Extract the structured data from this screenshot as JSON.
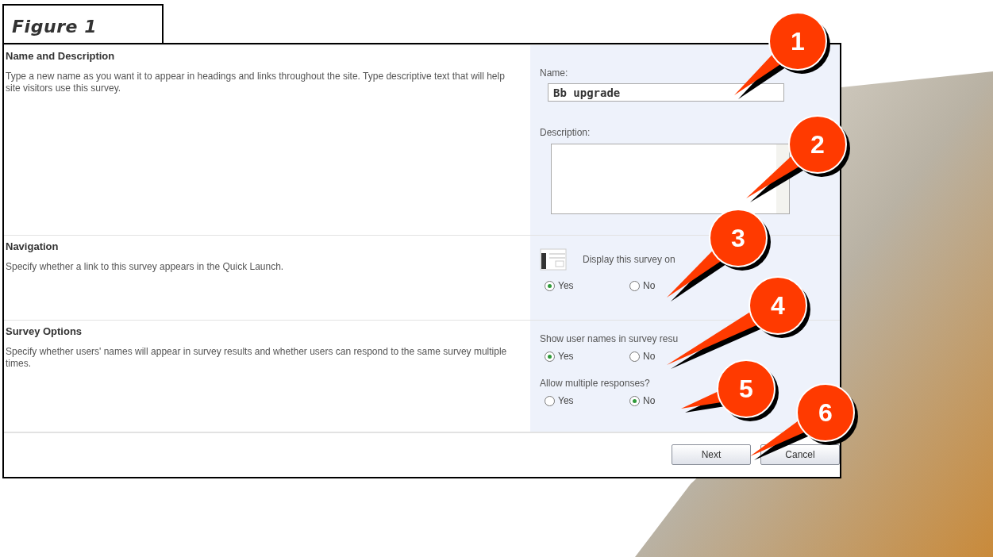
{
  "figure_label": "Figure 1",
  "sections": [
    {
      "title": "Name and Description",
      "description": "Type a new name as you want it to appear in headings and links throughout the site. Type descriptive text that will help site visitors use this survey.",
      "fields": [
        {
          "kind": "text",
          "label": "Name:",
          "value": "Bb upgrade"
        },
        {
          "kind": "textarea",
          "label": "Description:"
        }
      ]
    },
    {
      "title": "Navigation",
      "description": "Specify whether a link to this survey appears in the Quick Launch.",
      "fields": [
        {
          "kind": "icon-label",
          "label": "Display this survey on"
        },
        {
          "kind": "radio",
          "options": [
            {
              "label": "Yes",
              "selected": true
            },
            {
              "label": "No",
              "selected": false
            }
          ]
        }
      ]
    },
    {
      "title": "Survey Options",
      "description": "Specify whether users' names will appear in survey results and whether users can respond to the same survey multiple times.",
      "fields": [
        {
          "kind": "label",
          "label": "Show user names in survey resu"
        },
        {
          "kind": "radio",
          "options": [
            {
              "label": "Yes",
              "selected": true
            },
            {
              "label": "No",
              "selected": false
            }
          ]
        },
        {
          "kind": "label",
          "label": "Allow multiple responses?"
        },
        {
          "kind": "radio",
          "options": [
            {
              "label": "Yes",
              "selected": false
            },
            {
              "label": "No",
              "selected": true
            }
          ]
        }
      ]
    }
  ],
  "buttons": [
    "Next",
    "Cancel"
  ],
  "callouts": [
    "1",
    "2",
    "3",
    "4",
    "5",
    "6"
  ]
}
